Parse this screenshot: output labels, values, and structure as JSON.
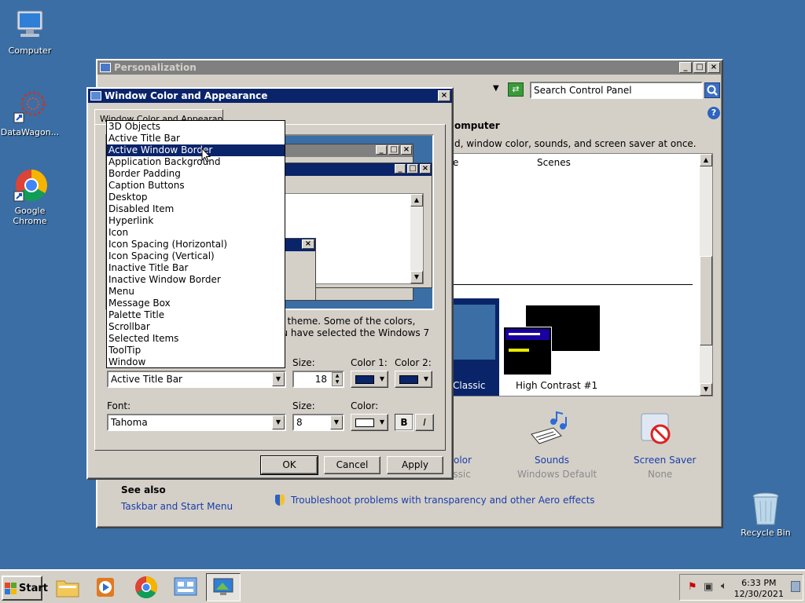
{
  "desktop": {
    "icons": [
      {
        "label": "Computer"
      },
      {
        "label": "DataWagon..."
      },
      {
        "label": "Google Chrome"
      },
      {
        "label": "Recycle Bin"
      }
    ]
  },
  "personalization": {
    "title": "Personalization",
    "search_placeholder": "Search Control Panel",
    "heading": "omputer",
    "subtitle": "d, window color, sounds, and screen saver at once.",
    "col_e": "e",
    "col_scenes": "Scenes",
    "theme_classic": "Classic",
    "theme_hc": "High Contrast #1",
    "items": [
      {
        "label": "olor",
        "sub": "assic"
      },
      {
        "label": "Sounds",
        "sub": "Windows Default"
      },
      {
        "label": "Screen Saver",
        "sub": "None"
      }
    ],
    "see_also": "See also",
    "taskbar_link": "Taskbar and Start Menu",
    "troubleshoot_link": "Troubleshoot problems with transparency and other Aero effects"
  },
  "dialog": {
    "title": "Window Color and Appearance",
    "tab": "Window Color and Appearance",
    "desc_line1": "s 7 theme.  Some of the colors,",
    "desc_line2": "you have selected the Windows 7",
    "item_label": "Item:",
    "item_value": "Active Title Bar",
    "size_label": "Size:",
    "size_value": "18",
    "color1_label": "Color 1:",
    "color2_label": "Color 2:",
    "font_label": "Font:",
    "font_value": "Tahoma",
    "font_size_label": "Size:",
    "font_size_value": "8",
    "font_color_label": "Color:",
    "bold_label": "B",
    "italic_label": "I",
    "ok": "OK",
    "cancel": "Cancel",
    "apply": "Apply",
    "list": [
      "3D Objects",
      "Active Title Bar",
      "Active Window Border",
      "Application Background",
      "Border Padding",
      "Caption Buttons",
      "Desktop",
      "Disabled Item",
      "Hyperlink",
      "Icon",
      "Icon Spacing (Horizontal)",
      "Icon Spacing (Vertical)",
      "Inactive Title Bar",
      "Inactive Window Border",
      "Menu",
      "Message Box",
      "Palette Title",
      "Scrollbar",
      "Selected Items",
      "ToolTip",
      "Window"
    ],
    "selected_index": 2
  },
  "taskbar": {
    "start": "Start",
    "time": "6:33 PM",
    "date": "12/30/2021"
  },
  "colors": {
    "desktop": "#3a6ea5",
    "title_active": "#0a246a",
    "face": "#d4d0c8",
    "link": "#1a3ea8"
  }
}
